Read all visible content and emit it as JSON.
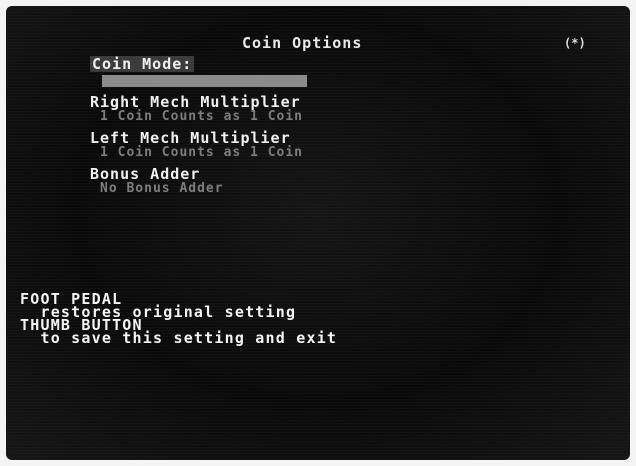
{
  "screen": {
    "title": "Coin Options",
    "corner_marker": "(*)"
  },
  "options": [
    {
      "label": "Coin Mode:",
      "value": ""
    },
    {
      "label": "Right Mech Multiplier",
      "value": "1 Coin Counts as 1 Coin"
    },
    {
      "label": "Left Mech Multiplier",
      "value": "1 Coin Counts as 1 Coin"
    },
    {
      "label": "Bonus Adder",
      "value": "No Bonus Adder"
    }
  ],
  "instructions": {
    "line1": "FOOT PEDAL",
    "line2": "  restores original setting",
    "line3": "THUMB BUTTON",
    "line4": "  to save this setting and exit"
  }
}
